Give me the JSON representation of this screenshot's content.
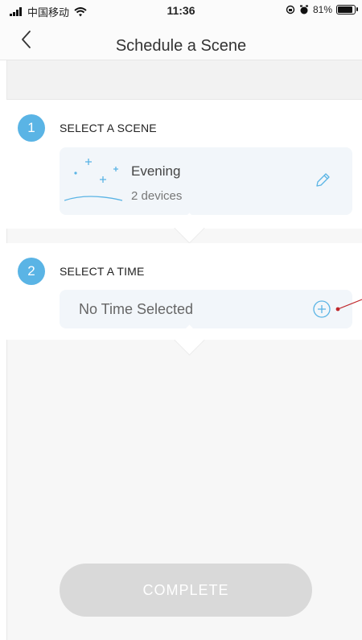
{
  "status_bar": {
    "carrier": "中国移动",
    "time": "11:36",
    "battery_text": "81%"
  },
  "nav": {
    "title": "Schedule a Scene",
    "back_icon": "chevron-left-icon"
  },
  "steps": [
    {
      "number": "1",
      "heading": "SELECT A SCENE",
      "scene": {
        "name": "Evening",
        "devices": "2 devices",
        "icon": "sparkle-icon",
        "edit_icon": "pencil-icon"
      }
    },
    {
      "number": "2",
      "heading": "SELECT A TIME",
      "time_value": "No Time Selected",
      "add_icon": "plus-circle-icon"
    }
  ],
  "complete_label": "COMPLETE",
  "colors": {
    "accent": "#5ab4e5",
    "card_bg": "#f2f6fa",
    "disabled_button": "#d9d9d9",
    "annotation_red": "#c0282c"
  }
}
